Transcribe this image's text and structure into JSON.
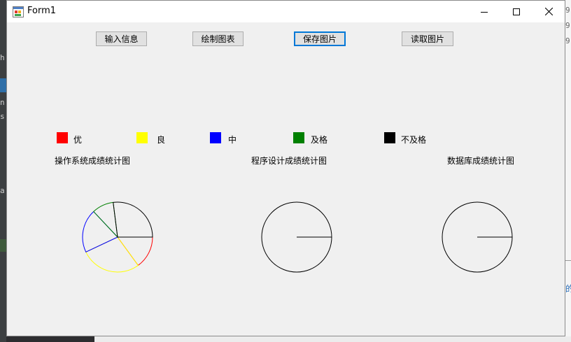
{
  "window": {
    "title": "Form1"
  },
  "toolbar": {
    "input_label": "输入信息",
    "draw_label": "绘制图表",
    "save_label": "保存图片",
    "read_label": "读取图片"
  },
  "legend": [
    {
      "label": "优",
      "color": "#ff0000"
    },
    {
      "label": "良",
      "color": "#ffff00"
    },
    {
      "label": "中",
      "color": "#0000ff"
    },
    {
      "label": "及格",
      "color": "#008000"
    },
    {
      "label": "不及格",
      "color": "#000000"
    }
  ],
  "chart_data": [
    {
      "type": "pie",
      "title": "操作系统成绩统计图",
      "categories": [
        "优",
        "良",
        "中",
        "及格",
        "不及格"
      ],
      "values": [
        15,
        28,
        20,
        10,
        27
      ]
    },
    {
      "type": "pie",
      "title": "程序设计成绩统计图",
      "categories": [
        "优",
        "良",
        "中",
        "及格",
        "不及格"
      ],
      "values": [
        0,
        0,
        0,
        0,
        0
      ]
    },
    {
      "type": "pie",
      "title": "数据库成绩统计图",
      "categories": [
        "优",
        "良",
        "中",
        "及格",
        "不及格"
      ],
      "values": [
        0,
        0,
        0,
        0,
        0
      ]
    }
  ]
}
